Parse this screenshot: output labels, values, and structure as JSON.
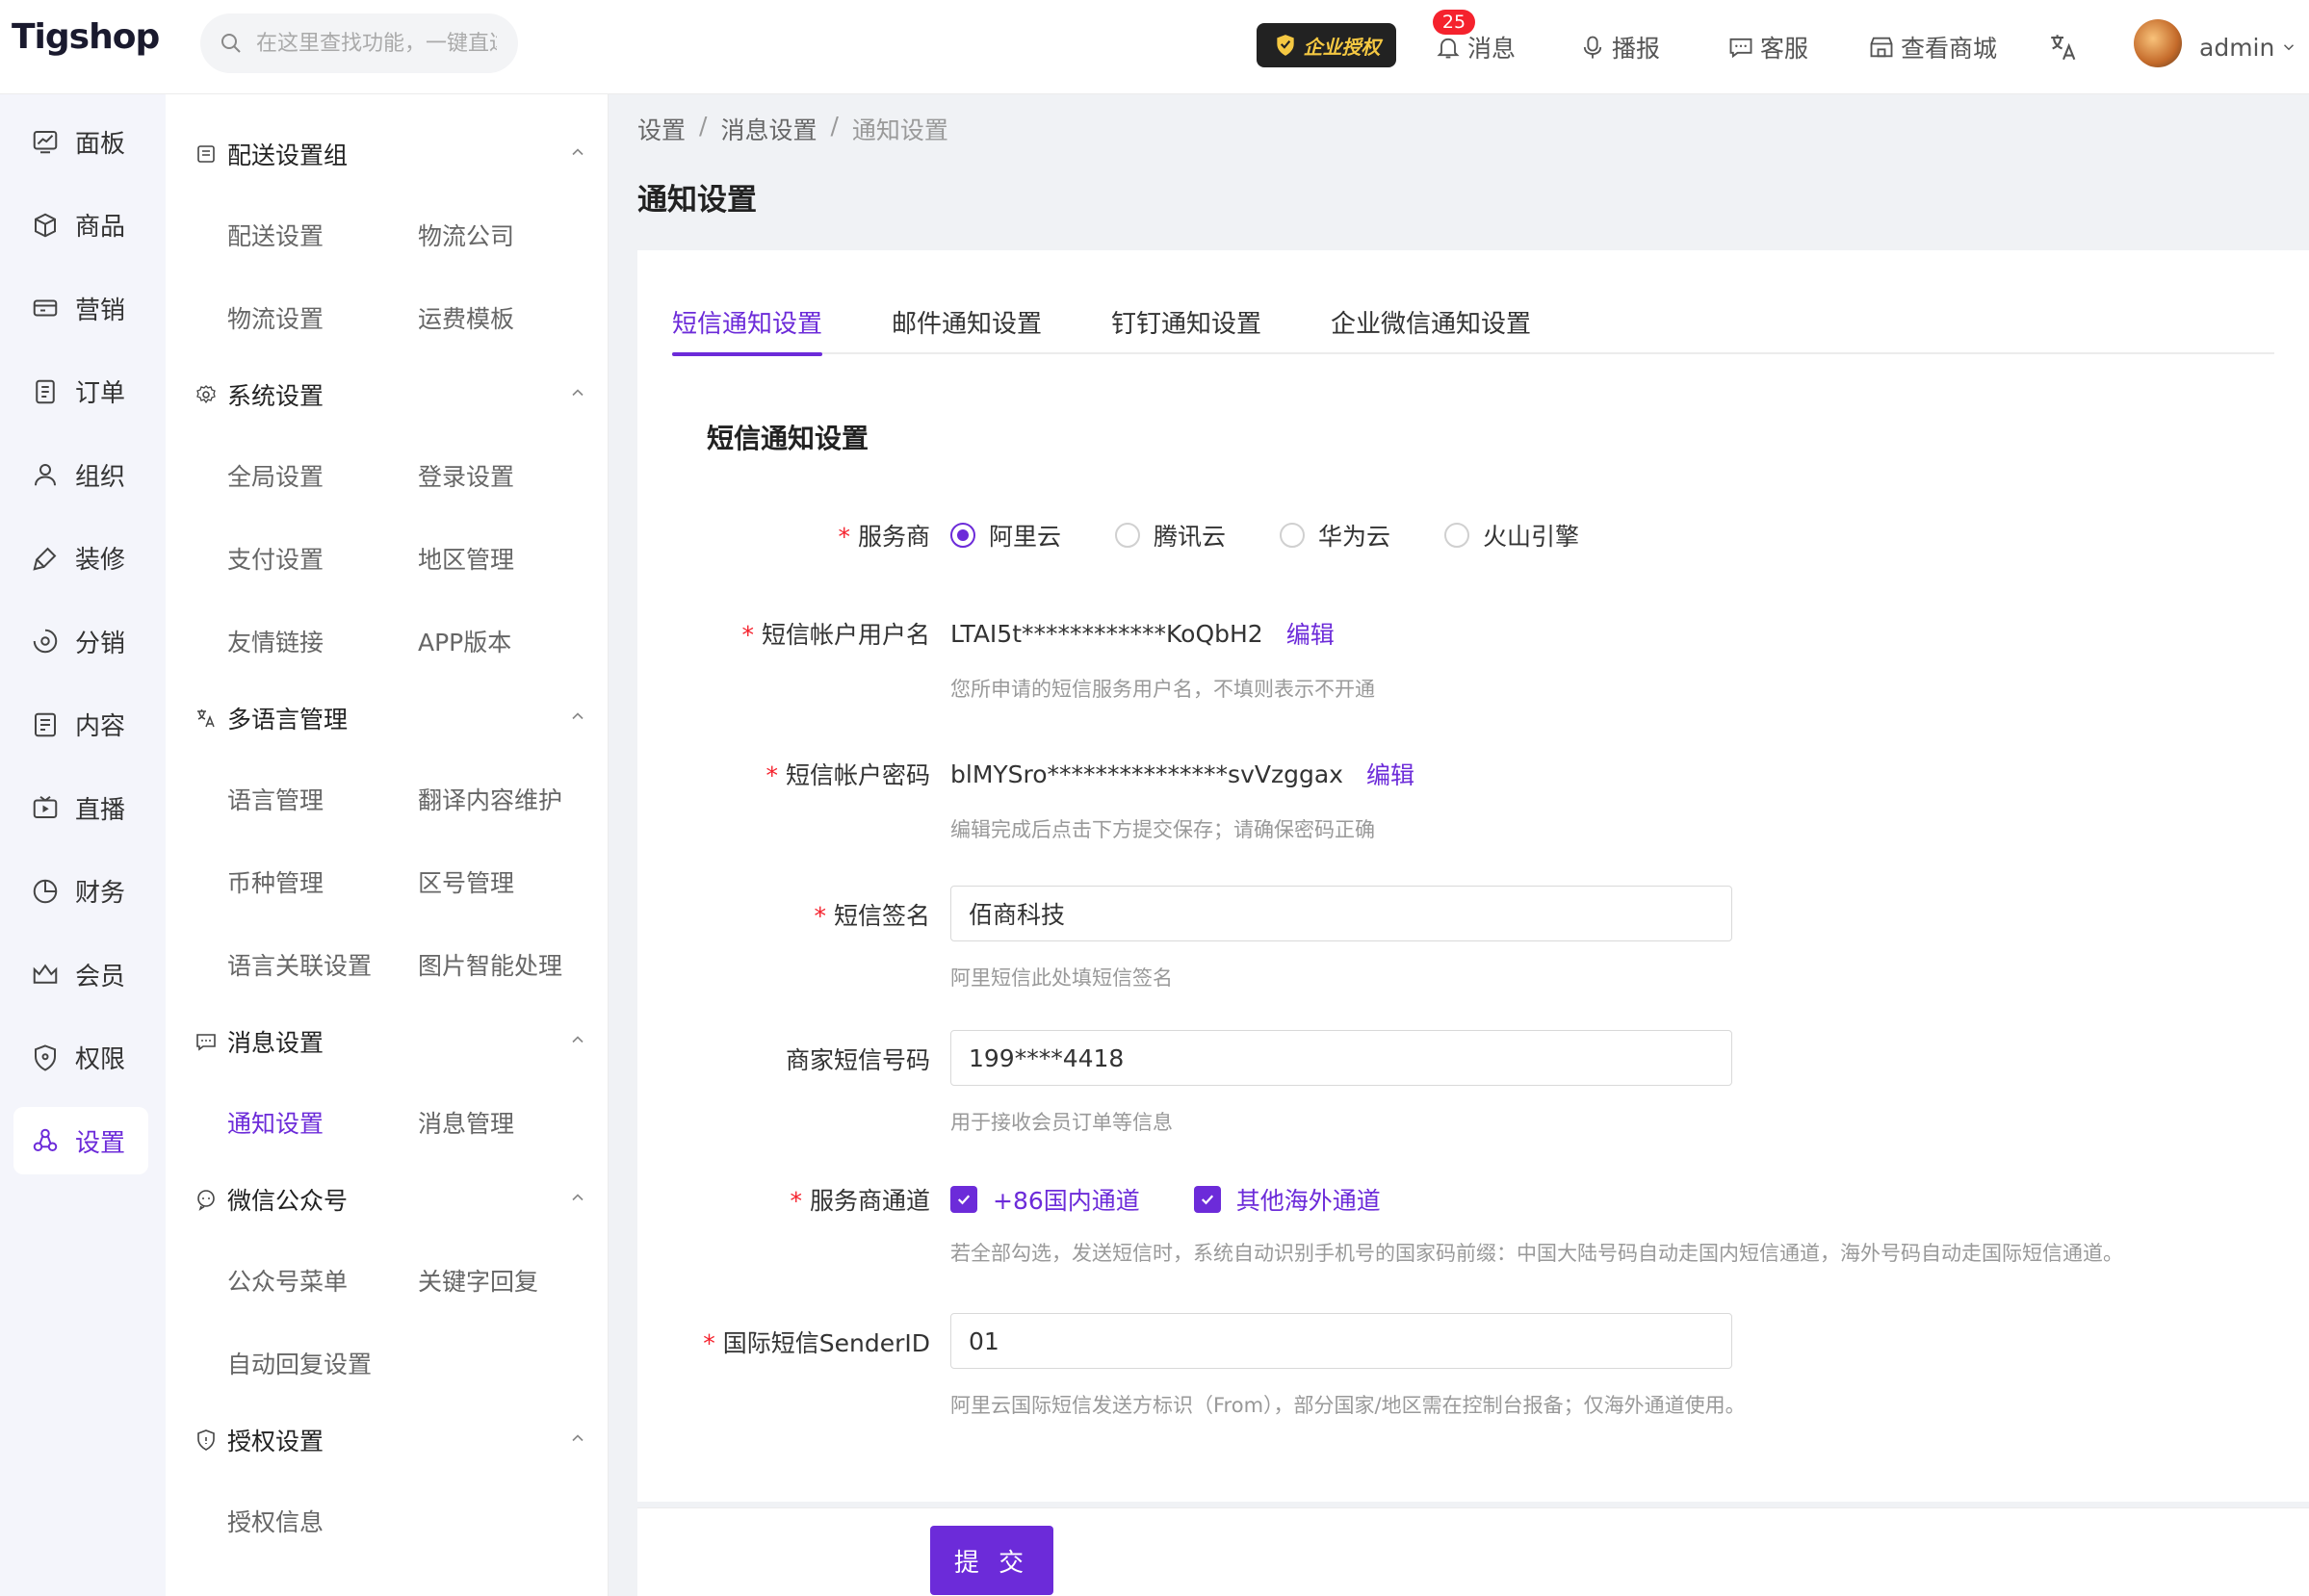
{
  "app": {
    "logo": "Tigshop"
  },
  "header": {
    "search_placeholder": "在这里查找功能，一键直达",
    "enterprise_badge": "企业授权",
    "notification_count": "25",
    "messages": "消息",
    "broadcast": "播报",
    "service": "客服",
    "view_store": "查看商城",
    "user": "admin"
  },
  "leftnav": [
    {
      "label": "面板",
      "icon": "dashboard-icon"
    },
    {
      "label": "商品",
      "icon": "box-icon"
    },
    {
      "label": "营销",
      "icon": "marketing-icon"
    },
    {
      "label": "订单",
      "icon": "order-icon"
    },
    {
      "label": "组织",
      "icon": "user-icon"
    },
    {
      "label": "装修",
      "icon": "brush-icon"
    },
    {
      "label": "分销",
      "icon": "share-icon"
    },
    {
      "label": "内容",
      "icon": "content-icon"
    },
    {
      "label": "直播",
      "icon": "live-icon"
    },
    {
      "label": "财务",
      "icon": "finance-icon"
    },
    {
      "label": "会员",
      "icon": "crown-icon"
    },
    {
      "label": "权限",
      "icon": "shield-icon"
    },
    {
      "label": "设置",
      "icon": "settings-icon",
      "active": true
    }
  ],
  "submenu": {
    "g1": {
      "title": "配送设置组",
      "items": [
        "配送设置",
        "物流公司",
        "物流设置",
        "运费模板"
      ]
    },
    "g2": {
      "title": "系统设置",
      "items": [
        "全局设置",
        "登录设置",
        "支付设置",
        "地区管理",
        "友情链接",
        "APP版本"
      ]
    },
    "g3": {
      "title": "多语言管理",
      "items": [
        "语言管理",
        "翻译内容维护",
        "币种管理",
        "区号管理",
        "语言关联设置",
        "图片智能处理"
      ]
    },
    "g4": {
      "title": "消息设置",
      "items": [
        "通知设置",
        "消息管理"
      ]
    },
    "g5": {
      "title": "微信公众号",
      "items": [
        "公众号菜单",
        "关键字回复",
        "自动回复设置"
      ]
    },
    "g6": {
      "title": "授权设置",
      "items": [
        "授权信息"
      ]
    }
  },
  "breadcrumb": [
    "设置",
    "消息设置",
    "通知设置"
  ],
  "page_title": "通知设置",
  "tabs": [
    "短信通知设置",
    "邮件通知设置",
    "钉钉通知设置",
    "企业微信通知设置"
  ],
  "section_title": "短信通知设置",
  "form": {
    "provider": {
      "label": "服务商",
      "options": [
        "阿里云",
        "腾讯云",
        "华为云",
        "火山引擎"
      ],
      "selected": "阿里云"
    },
    "username": {
      "label": "短信帐户用户名",
      "value": "LTAI5t************KoQbH2",
      "edit": "编辑",
      "hint": "您所申请的短信服务用户名，不填则表示不开通"
    },
    "password": {
      "label": "短信帐户密码",
      "value": "blMYSro***************svVzggax",
      "edit": "编辑",
      "hint": "编辑完成后点击下方提交保存；请确保密码正确"
    },
    "signature": {
      "label": "短信签名",
      "value": "佰商科技",
      "hint": "阿里短信此处填短信签名"
    },
    "merchant_phone": {
      "label": "商家短信号码",
      "value": "199****4418",
      "hint": "用于接收会员订单等信息"
    },
    "channel": {
      "label": "服务商通道",
      "options": [
        "+86国内通道",
        "其他海外通道"
      ],
      "hint": "若全部勾选，发送短信时，系统自动识别手机号的国家码前缀：中国大陆号码自动走国内短信通道，海外号码自动走国际短信通道。"
    },
    "sender_id": {
      "label": "国际短信SenderID",
      "value": "01",
      "hint": "阿里云国际短信发送方标识（From），部分国家/地区需在控制台报备；仅海外通道使用。"
    }
  },
  "submit_label": "提 交",
  "colors": {
    "accent": "#6c2bd9",
    "required": "#f5222d",
    "badge": "#f5222d"
  }
}
